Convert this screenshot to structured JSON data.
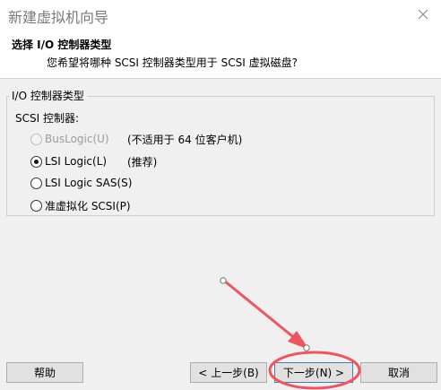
{
  "window": {
    "title": "新建虚拟机向导",
    "close_icon": "close-icon"
  },
  "header": {
    "title": "选择 I/O 控制器类型",
    "subtitle": "您希望将哪种 SCSI 控制器类型用于 SCSI 虚拟磁盘?"
  },
  "group": {
    "title": "I/O 控制器类型",
    "scsi_label": "SCSI 控制器:"
  },
  "options": [
    {
      "label": "BusLogic(U)",
      "note": "(不适用于 64 位客户机)",
      "checked": false,
      "disabled": true
    },
    {
      "label": "LSI Logic(L)",
      "note": "(推荐)",
      "checked": true,
      "disabled": false
    },
    {
      "label": "LSI Logic SAS(S)",
      "note": "",
      "checked": false,
      "disabled": false
    },
    {
      "label": "准虚拟化 SCSI(P)",
      "note": "",
      "checked": false,
      "disabled": false
    }
  ],
  "buttons": {
    "help": "帮助",
    "back": "< 上一步(B)",
    "next": "下一步(N) >",
    "cancel": "取消"
  },
  "colors": {
    "annotation": "#f0555f",
    "background": "#f0f0f0"
  }
}
